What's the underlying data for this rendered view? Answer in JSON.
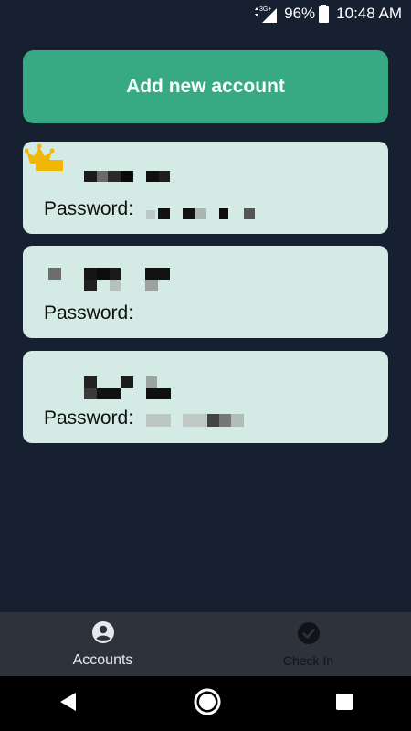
{
  "status_bar": {
    "network": "3G+",
    "battery_percent": "96%",
    "time": "10:48 AM"
  },
  "add_button": {
    "label": "Add new account"
  },
  "accounts": [
    {
      "password_label": "Password:",
      "is_primary": true
    },
    {
      "password_label": "Password:",
      "is_primary": false
    },
    {
      "password_label": "Password:",
      "is_primary": false
    }
  ],
  "bottom_nav": {
    "tabs": [
      {
        "label": "Accounts",
        "icon": "account-circle-icon",
        "active": true
      },
      {
        "label": "Check In",
        "icon": "check-circle-icon",
        "active": false
      }
    ]
  },
  "system_nav": {
    "icons": [
      "back-icon",
      "home-icon",
      "recents-icon"
    ]
  },
  "colors": {
    "background": "#172031",
    "accent": "#38aa83",
    "card": "#d4eae5",
    "nav_bar": "#2e323b",
    "crown": "#f2b705"
  }
}
